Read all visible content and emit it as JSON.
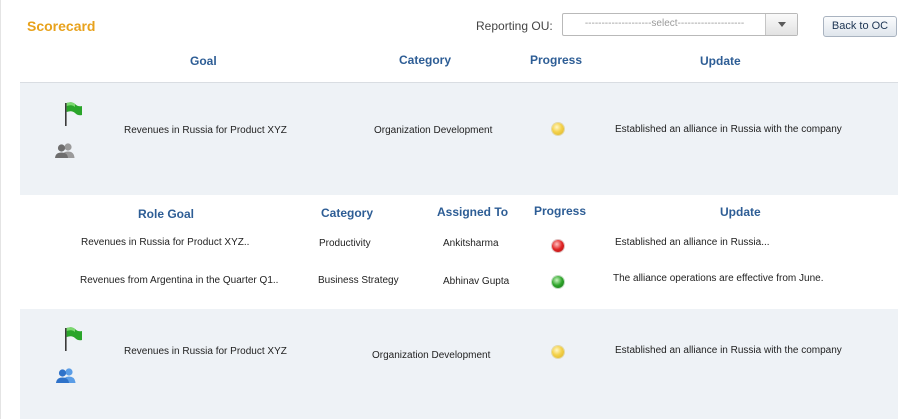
{
  "header": {
    "title": "Scorecard",
    "reporting_ou_label": "Reporting OU:",
    "reporting_ou_value": "--------------------select--------------------",
    "back_button": "Back to OC"
  },
  "goal_table": {
    "columns": {
      "goal": "Goal",
      "category": "Category",
      "progress": "Progress",
      "update": "Update"
    }
  },
  "goals": [
    {
      "goal": "Revenues in Russia for Product XYZ",
      "category": "Organization Development",
      "progress": "yellow",
      "update": "Established an alliance in Russia with the company",
      "icons": [
        "green-flag-icon",
        "gray-people-icon"
      ]
    },
    {
      "goal": "Revenues in Russia for Product XYZ",
      "category": "Organization Development",
      "progress": "yellow",
      "update": "Established an alliance in Russia with the company",
      "icons": [
        "green-flag-icon",
        "blue-people-icon"
      ]
    }
  ],
  "role_table": {
    "columns": {
      "role_goal": "Role Goal",
      "category": "Category",
      "assigned_to": "Assigned To",
      "progress": "Progress",
      "update": "Update"
    }
  },
  "role_goals": [
    {
      "role_goal": "Revenues in Russia for Product XYZ..",
      "category": "Productivity",
      "assigned_to": "Ankitsharma",
      "progress": "red",
      "update": "Established an alliance in Russia..."
    },
    {
      "role_goal": "Revenues from Argentina in the Quarter Q1..",
      "category": "Business Strategy",
      "assigned_to": "Abhinav Gupta",
      "progress": "green",
      "update": "The alliance operations are effective from June."
    }
  ],
  "colors": {
    "title": "#e8a21c",
    "header_text": "#2d5d95",
    "band": "#eef2f6",
    "status_yellow": "#f4d24b",
    "status_red": "#e02424",
    "status_green": "#2ea52a",
    "flag": "#2aa52a",
    "people_blue": "#2e72c9",
    "people_gray": "#7d7d7d"
  }
}
